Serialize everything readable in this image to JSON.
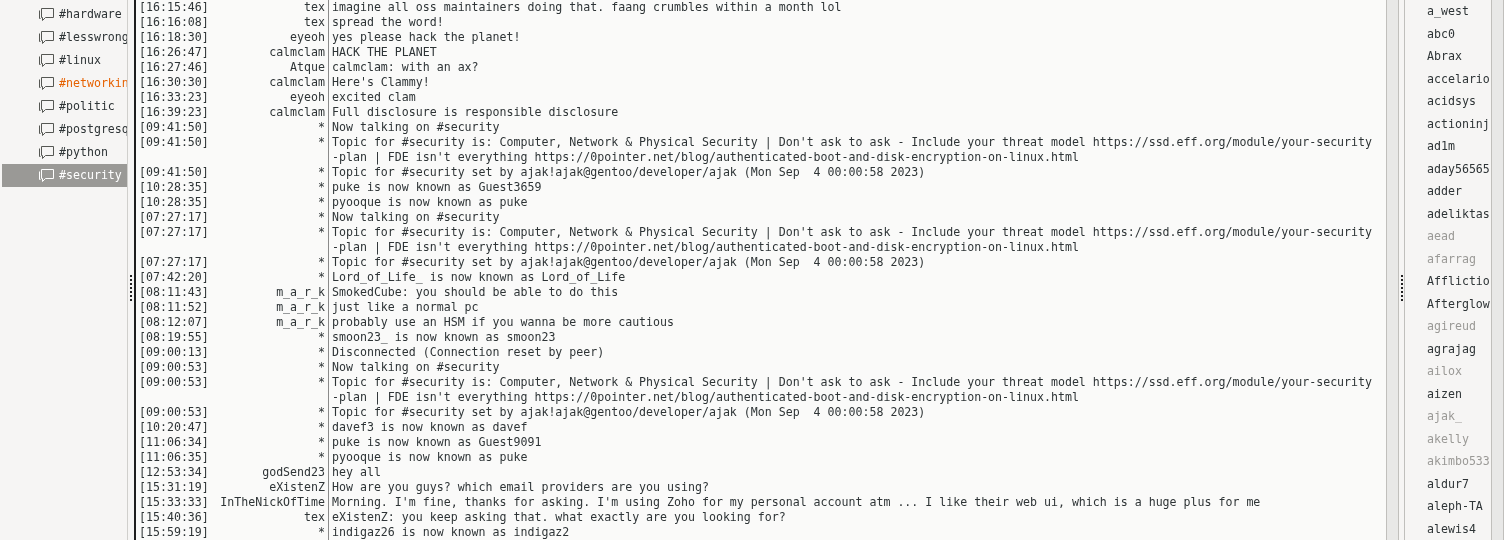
{
  "channels": [
    {
      "name": "#hardware",
      "selected": false,
      "activity": false
    },
    {
      "name": "#lesswrong",
      "selected": false,
      "activity": false
    },
    {
      "name": "#linux",
      "selected": false,
      "activity": false
    },
    {
      "name": "#networkin",
      "selected": false,
      "activity": true
    },
    {
      "name": "#politic",
      "selected": false,
      "activity": false
    },
    {
      "name": "#postgresq",
      "selected": false,
      "activity": false
    },
    {
      "name": "#python",
      "selected": false,
      "activity": false
    },
    {
      "name": "#security",
      "selected": true,
      "activity": false
    }
  ],
  "messages": [
    {
      "time": "[16:15:46]",
      "nick": "tex",
      "text": "imagine all oss maintainers doing that. faang crumbles within a month lol"
    },
    {
      "time": "[16:16:08]",
      "nick": "tex",
      "text": "spread the word!"
    },
    {
      "time": "[16:18:30]",
      "nick": "eyeoh",
      "text": "yes please hack the planet!"
    },
    {
      "time": "[16:26:47]",
      "nick": "calmclam",
      "text": "HACK THE PLANET"
    },
    {
      "time": "[16:27:46]",
      "nick": "Atque",
      "text": "calmclam: with an ax?"
    },
    {
      "time": "[16:30:30]",
      "nick": "calmclam",
      "text": "Here's Clammy!"
    },
    {
      "time": "[16:33:23]",
      "nick": "eyeoh",
      "text": "excited clam"
    },
    {
      "time": "[16:39:23]",
      "nick": "calmclam",
      "text": "Full disclosure is responsible disclosure"
    },
    {
      "time": "[09:41:50]",
      "nick": "*",
      "text": "Now talking on #security"
    },
    {
      "time": "[09:41:50]",
      "nick": "*",
      "text": "Topic for #security is: Computer, Network & Physical Security | Don't ask to ask - Include your threat model https://ssd.eff.org/module/your-security-plan | FDE isn't everything https://0pointer.net/blog/authenticated-boot-and-disk-encryption-on-linux.html"
    },
    {
      "time": "[09:41:50]",
      "nick": "*",
      "text": "Topic for #security set by ajak!ajak@gentoo/developer/ajak (Mon Sep  4 00:00:58 2023)"
    },
    {
      "time": "[10:28:35]",
      "nick": "*",
      "text": "puke is now known as Guest3659"
    },
    {
      "time": "[10:28:35]",
      "nick": "*",
      "text": "pyooque is now known as puke"
    },
    {
      "time": "[07:27:17]",
      "nick": "*",
      "text": "Now talking on #security"
    },
    {
      "time": "[07:27:17]",
      "nick": "*",
      "text": "Topic for #security is: Computer, Network & Physical Security | Don't ask to ask - Include your threat model https://ssd.eff.org/module/your-security-plan | FDE isn't everything https://0pointer.net/blog/authenticated-boot-and-disk-encryption-on-linux.html"
    },
    {
      "time": "[07:27:17]",
      "nick": "*",
      "text": "Topic for #security set by ajak!ajak@gentoo/developer/ajak (Mon Sep  4 00:00:58 2023)"
    },
    {
      "time": "[07:42:20]",
      "nick": "*",
      "text": "Lord_of_Life_ is now known as Lord_of_Life"
    },
    {
      "time": "[08:11:43]",
      "nick": "m_a_r_k",
      "text": "SmokedCube: you should be able to do this"
    },
    {
      "time": "[08:11:52]",
      "nick": "m_a_r_k",
      "text": "just like a normal pc"
    },
    {
      "time": "[08:12:07]",
      "nick": "m_a_r_k",
      "text": "probably use an HSM if you wanna be more cautious"
    },
    {
      "time": "[08:19:55]",
      "nick": "*",
      "text": "smoon23_ is now known as smoon23"
    },
    {
      "time": "[09:00:13]",
      "nick": "*",
      "text": "Disconnected (Connection reset by peer)"
    },
    {
      "time": "[09:00:53]",
      "nick": "*",
      "text": "Now talking on #security"
    },
    {
      "time": "[09:00:53]",
      "nick": "*",
      "text": "Topic for #security is: Computer, Network & Physical Security | Don't ask to ask - Include your threat model https://ssd.eff.org/module/your-security-plan | FDE isn't everything https://0pointer.net/blog/authenticated-boot-and-disk-encryption-on-linux.html"
    },
    {
      "time": "[09:00:53]",
      "nick": "*",
      "text": "Topic for #security set by ajak!ajak@gentoo/developer/ajak (Mon Sep  4 00:00:58 2023)"
    },
    {
      "time": "[10:20:47]",
      "nick": "*",
      "text": "davef3 is now known as davef"
    },
    {
      "time": "[11:06:34]",
      "nick": "*",
      "text": "puke is now known as Guest9091"
    },
    {
      "time": "[11:06:35]",
      "nick": "*",
      "text": "pyooque is now known as puke"
    },
    {
      "time": "[12:53:34]",
      "nick": "godSend23",
      "text": "hey all"
    },
    {
      "time": "[15:31:19]",
      "nick": "eXistenZ",
      "text": "How are you guys? which email providers are you using?"
    },
    {
      "time": "[15:33:33]",
      "nick": "InTheNickOfTime",
      "text": "Morning. I'm fine, thanks for asking. I'm using Zoho for my personal account atm ... I like their web ui, which is a huge plus for me"
    },
    {
      "time": "[15:40:36]",
      "nick": "tex",
      "text": "eXistenZ: you keep asking that. what exactly are you looking for?"
    },
    {
      "time": "[15:59:19]",
      "nick": "*",
      "text": "indigaz26 is now known as indigaz2"
    }
  ],
  "users": [
    {
      "name": "a_west",
      "away": false
    },
    {
      "name": "abc0",
      "away": false
    },
    {
      "name": "Abrax",
      "away": false
    },
    {
      "name": "accelario",
      "away": false
    },
    {
      "name": "acidsys",
      "away": false
    },
    {
      "name": "actioninj",
      "away": false
    },
    {
      "name": "ad1m",
      "away": false
    },
    {
      "name": "aday56565",
      "away": false
    },
    {
      "name": "adder",
      "away": false
    },
    {
      "name": "adeliktas",
      "away": false
    },
    {
      "name": "aead",
      "away": true
    },
    {
      "name": "afarrag",
      "away": true
    },
    {
      "name": "Afflictio",
      "away": false
    },
    {
      "name": "Afterglow",
      "away": false
    },
    {
      "name": "agireud",
      "away": true
    },
    {
      "name": "agrajag",
      "away": false
    },
    {
      "name": "ailox",
      "away": true
    },
    {
      "name": "aizen",
      "away": false
    },
    {
      "name": "ajak_",
      "away": true
    },
    {
      "name": "akelly",
      "away": true
    },
    {
      "name": "akimbo533",
      "away": true
    },
    {
      "name": "aldur7",
      "away": false
    },
    {
      "name": "aleph-TA",
      "away": false
    },
    {
      "name": "alewis4",
      "away": false
    }
  ]
}
